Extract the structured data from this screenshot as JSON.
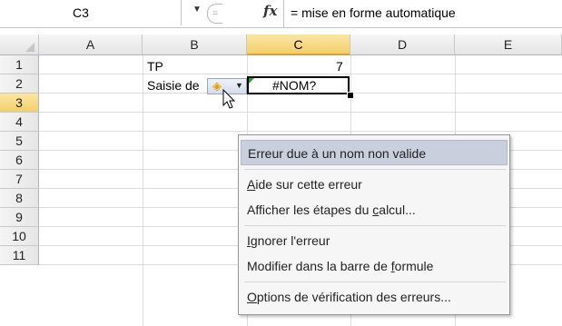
{
  "formula_bar": {
    "name_box": "C3",
    "formula": "= mise en forme automatique"
  },
  "columns": [
    "A",
    "B",
    "C",
    "D",
    "E"
  ],
  "active_column": "C",
  "rows": [
    "1",
    "2",
    "3",
    "4",
    "5",
    "6",
    "7",
    "8",
    "9",
    "10",
    "11"
  ],
  "active_row": "3",
  "cells": {
    "B2": "TP",
    "C2": "7",
    "B3": "Saisie de",
    "C3": "#NOM?"
  },
  "context_menu": {
    "header": "Erreur due à un nom non valide",
    "items": [
      {
        "pre": "",
        "key": "A",
        "post": "ide sur cette erreur"
      },
      {
        "pre": "Afficher les étapes du ",
        "key": "c",
        "post": "alcul..."
      },
      {
        "pre": "",
        "key": "I",
        "post": "gnorer l'erreur"
      },
      {
        "pre": "Modifier dans la barre de ",
        "key": "f",
        "post": "ormule"
      },
      {
        "pre": "",
        "key": "O",
        "post": "ptions de vérification des erreurs..."
      }
    ]
  },
  "colors": {
    "selection_border": "#000000",
    "error_indicator": "#2a9a2a",
    "menu_highlight": "#c9cfdd",
    "active_header": "#f3cf6a"
  },
  "icons": {
    "smart_tag": "error-warning-icon",
    "cursor": "arrow-cursor-icon",
    "fx": "function-icon"
  }
}
